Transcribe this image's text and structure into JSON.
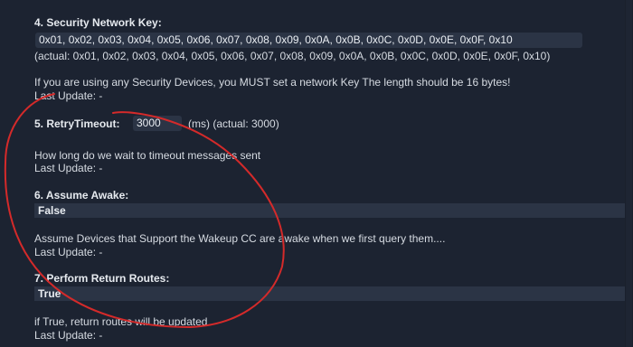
{
  "settings": {
    "key": {
      "label": "4. Security Network Key:",
      "value": "0x01, 0x02, 0x03, 0x04, 0x05, 0x06, 0x07, 0x08, 0x09, 0x0A, 0x0B, 0x0C, 0x0D, 0x0E, 0x0F, 0x10",
      "actual": "(actual: 0x01, 0x02, 0x03, 0x04, 0x05, 0x06, 0x07, 0x08, 0x09, 0x0A, 0x0B, 0x0C, 0x0D, 0x0E, 0x0F, 0x10)",
      "description": "If you are using any Security Devices, you MUST set a network Key The length should be 16 bytes!",
      "last_update": "Last Update: -"
    },
    "retry": {
      "label": "5. RetryTimeout:",
      "value": "3000",
      "suffix": "(ms) (actual: 3000)",
      "description": "How long do we wait to timeout messages sent",
      "last_update": "Last Update: -"
    },
    "awake": {
      "label": "6. Assume Awake:",
      "value": "False",
      "description": "Assume Devices that Support the Wakeup CC are awake when we first query them....",
      "last_update": "Last Update: -"
    },
    "routes": {
      "label": "7. Perform Return Routes:",
      "value": "True",
      "description": "if True, return routes will be updated",
      "last_update": "Last Update: -"
    }
  },
  "colors": {
    "background": "#1c2331",
    "field": "#2b3445",
    "annotation": "#d42a2a"
  }
}
